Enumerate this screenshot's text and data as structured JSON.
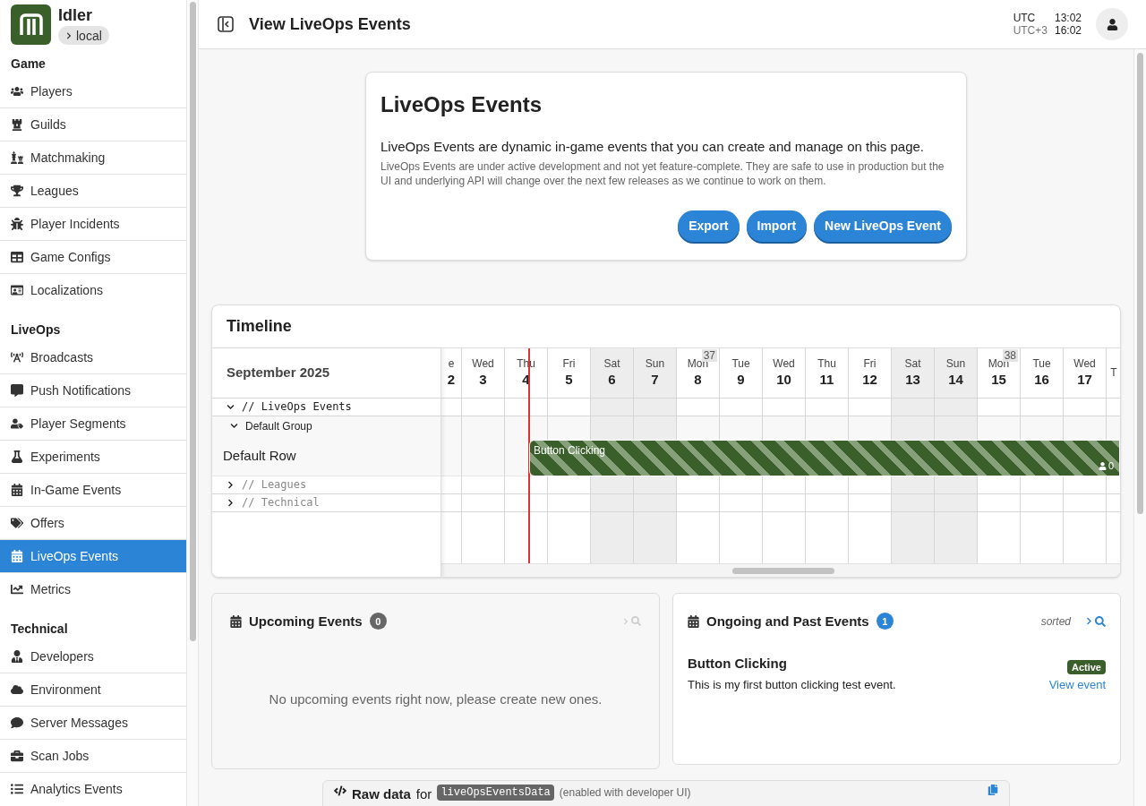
{
  "app": {
    "name": "Idler",
    "environment": "local"
  },
  "sidebar": {
    "sections": [
      {
        "title": "Game",
        "items": [
          {
            "label": "Players",
            "selected": false
          },
          {
            "label": "Guilds",
            "selected": false
          },
          {
            "label": "Matchmaking",
            "selected": false
          },
          {
            "label": "Leagues",
            "selected": false
          },
          {
            "label": "Player Incidents",
            "selected": false
          },
          {
            "label": "Game Configs",
            "selected": false
          },
          {
            "label": "Localizations",
            "selected": false
          }
        ]
      },
      {
        "title": "LiveOps",
        "items": [
          {
            "label": "Broadcasts",
            "selected": false
          },
          {
            "label": "Push Notifications",
            "selected": false
          },
          {
            "label": "Player Segments",
            "selected": false
          },
          {
            "label": "Experiments",
            "selected": false
          },
          {
            "label": "In-Game Events",
            "selected": false
          },
          {
            "label": "Offers",
            "selected": false
          },
          {
            "label": "LiveOps Events",
            "selected": true
          },
          {
            "label": "Metrics",
            "selected": false
          }
        ]
      },
      {
        "title": "Technical",
        "items": [
          {
            "label": "Developers",
            "selected": false
          },
          {
            "label": "Environment",
            "selected": false
          },
          {
            "label": "Server Messages",
            "selected": false
          },
          {
            "label": "Scan Jobs",
            "selected": false
          },
          {
            "label": "Analytics Events",
            "selected": false
          }
        ]
      }
    ]
  },
  "header": {
    "title": "View LiveOps Events",
    "clocks": [
      {
        "zone": "UTC",
        "time": "13:02"
      },
      {
        "zone": "UTC+3",
        "time": "16:02"
      }
    ]
  },
  "intro": {
    "title": "LiveOps Events",
    "lead": "LiveOps Events are dynamic in-game events that you can create and manage on this page.",
    "note": "LiveOps Events are under active development and not yet feature-complete. They are safe to use in production but the UI and underlying API will change over the next few releases as we continue to work on them.",
    "buttons": [
      "Export",
      "Import",
      "New LiveOps Event"
    ]
  },
  "timeline": {
    "title": "Timeline",
    "month": "September 2025",
    "columns": [
      {
        "day": "e",
        "date": "2",
        "weekend": false,
        "today": false
      },
      {
        "day": "Wed",
        "date": "3",
        "weekend": false,
        "today": false
      },
      {
        "day": "Thu",
        "date": "4",
        "weekend": false,
        "today": true
      },
      {
        "day": "Fri",
        "date": "5",
        "weekend": false,
        "today": false
      },
      {
        "day": "Sat",
        "date": "6",
        "weekend": true,
        "today": false
      },
      {
        "day": "Sun",
        "date": "7",
        "weekend": true,
        "today": false
      },
      {
        "day": "Mon",
        "date": "8",
        "weekend": false,
        "today": false,
        "week": "37"
      },
      {
        "day": "Tue",
        "date": "9",
        "weekend": false,
        "today": false
      },
      {
        "day": "Wed",
        "date": "10",
        "weekend": false,
        "today": false
      },
      {
        "day": "Thu",
        "date": "11",
        "weekend": false,
        "today": false
      },
      {
        "day": "Fri",
        "date": "12",
        "weekend": false,
        "today": false
      },
      {
        "day": "Sat",
        "date": "13",
        "weekend": true,
        "today": false
      },
      {
        "day": "Sun",
        "date": "14",
        "weekend": true,
        "today": false
      },
      {
        "day": "Mon",
        "date": "15",
        "weekend": false,
        "today": false,
        "week": "38"
      },
      {
        "day": "Tue",
        "date": "16",
        "weekend": false,
        "today": false
      },
      {
        "day": "Wed",
        "date": "17",
        "weekend": false,
        "today": false
      },
      {
        "day": "T",
        "weekend": false,
        "today": false
      }
    ],
    "groups": [
      {
        "label": "// LiveOps Events",
        "expanded": true,
        "children": [
          {
            "label": "Default Group",
            "expanded": true,
            "children": [
              {
                "label": "Default Row",
                "events": [
                  {
                    "name": "Button Clicking",
                    "participants": "0"
                  }
                ]
              }
            ]
          }
        ]
      },
      {
        "label": "// Leagues",
        "expanded": false
      },
      {
        "label": "// Technical",
        "expanded": false
      }
    ]
  },
  "upcoming": {
    "title": "Upcoming Events",
    "count": "0",
    "empty": "No upcoming events right now, please create new ones."
  },
  "ongoing": {
    "title": "Ongoing and Past Events",
    "count": "1",
    "sort": "sorted",
    "events": [
      {
        "name": "Button Clicking",
        "description": "This is my first button clicking test event.",
        "status": "Active",
        "link": "View event"
      }
    ]
  },
  "raw": {
    "title": "Raw data",
    "for": "for",
    "key": "liveOpsEventsData",
    "note": "(enabled with developer UI)"
  }
}
